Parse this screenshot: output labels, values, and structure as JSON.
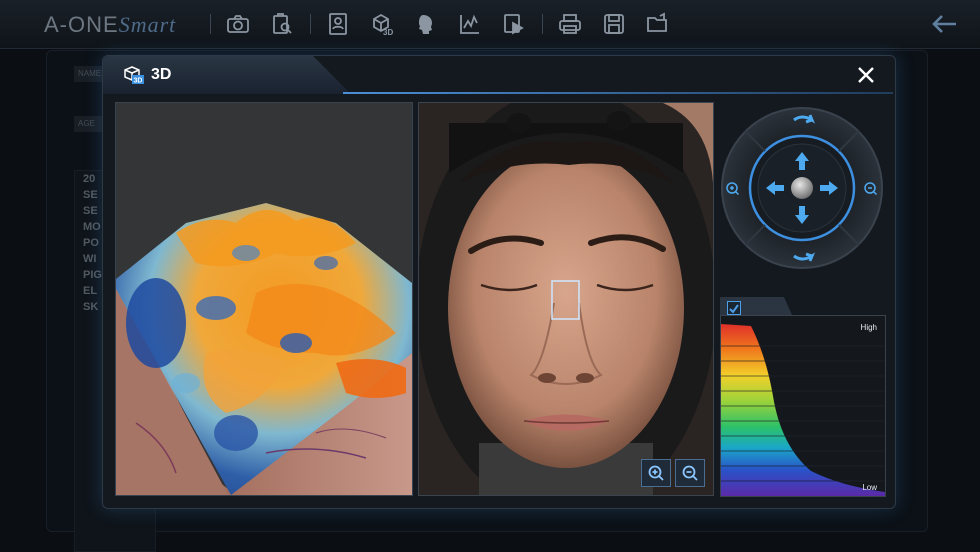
{
  "app": {
    "logo_main": "A-ONE",
    "logo_script": "Smart"
  },
  "toolbar": {
    "icons": [
      "camera-icon",
      "clipboard-search-icon",
      "profile-card-icon",
      "cube-3d-icon",
      "face-profile-icon",
      "chart-icon",
      "video-file-icon",
      "printer-icon",
      "save-icon",
      "folder-open-icon"
    ],
    "back_icon": "arrow-left-icon"
  },
  "background": {
    "fields": [
      "NAME",
      "AGE"
    ],
    "list_items": [
      "20",
      "SE",
      "SE",
      "MO",
      "PO",
      "WI",
      "PIG",
      "EL",
      "SK"
    ]
  },
  "modal": {
    "title": "3D",
    "close_icon": "close-icon",
    "zoom_in_icon": "zoom-in-icon",
    "zoom_out_icon": "zoom-out-icon"
  },
  "histogram": {
    "high_label": "High",
    "low_label": "Low",
    "checked": true
  },
  "colors": {
    "accent": "#4da0e8",
    "modal_bg": "#14191f",
    "highlight_box": "#cfe7ff"
  }
}
